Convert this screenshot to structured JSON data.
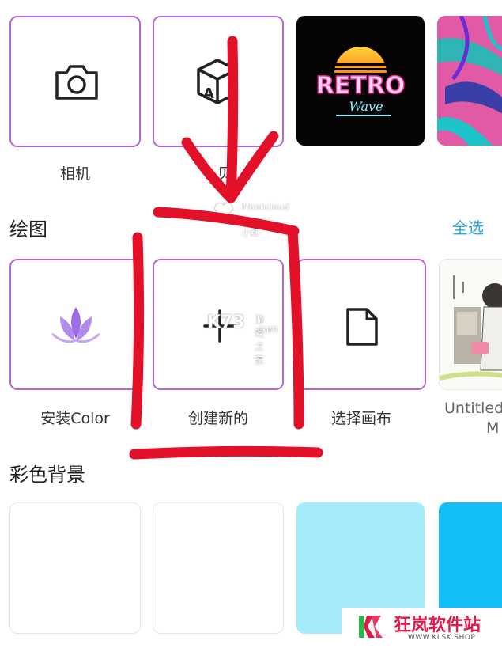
{
  "row1": {
    "items": [
      {
        "label": "相机",
        "icon": "camera-icon"
      },
      {
        "label": "L    贝",
        "icon": "ar-box-icon"
      },
      {
        "label": "",
        "thumbnail": "retro-wave-neon",
        "retro_word": "RETRO",
        "wave_word": "Wave"
      },
      {
        "label": "",
        "thumbnail": "tropical-leaves"
      }
    ]
  },
  "drawing": {
    "heading": "绘图",
    "select_all": "全选",
    "items": [
      {
        "label": "安装Color",
        "icon": "lotus-icon"
      },
      {
        "label": "创建新的",
        "icon": "plus-icon"
      },
      {
        "label": "选择画布",
        "icon": "document-icon"
      },
      {
        "label": "Untitled",
        "label_line2": "M",
        "thumbnail": "sketch-artwork"
      }
    ]
  },
  "colored_bg": {
    "heading": "彩色背景",
    "swatches": [
      "transparent",
      "#ffffff",
      "#a4ecfb",
      "#12bff9"
    ]
  },
  "watermarks": {
    "wm1_line1": "Mooncloud",
    "wm1_line2": "From 小红",
    "wm2_site": "游戏之家",
    "wm2_dom": ".com"
  },
  "site_badge": {
    "name": "狂岚软件站",
    "url": "WWW.KLSK.SHOP",
    "colors": {
      "pink": "#e6184a",
      "green": "#2fb34a"
    }
  },
  "colors": {
    "accent": "#25a9e8",
    "tile_border": "#b266d6",
    "annotation": "#e3102a"
  }
}
